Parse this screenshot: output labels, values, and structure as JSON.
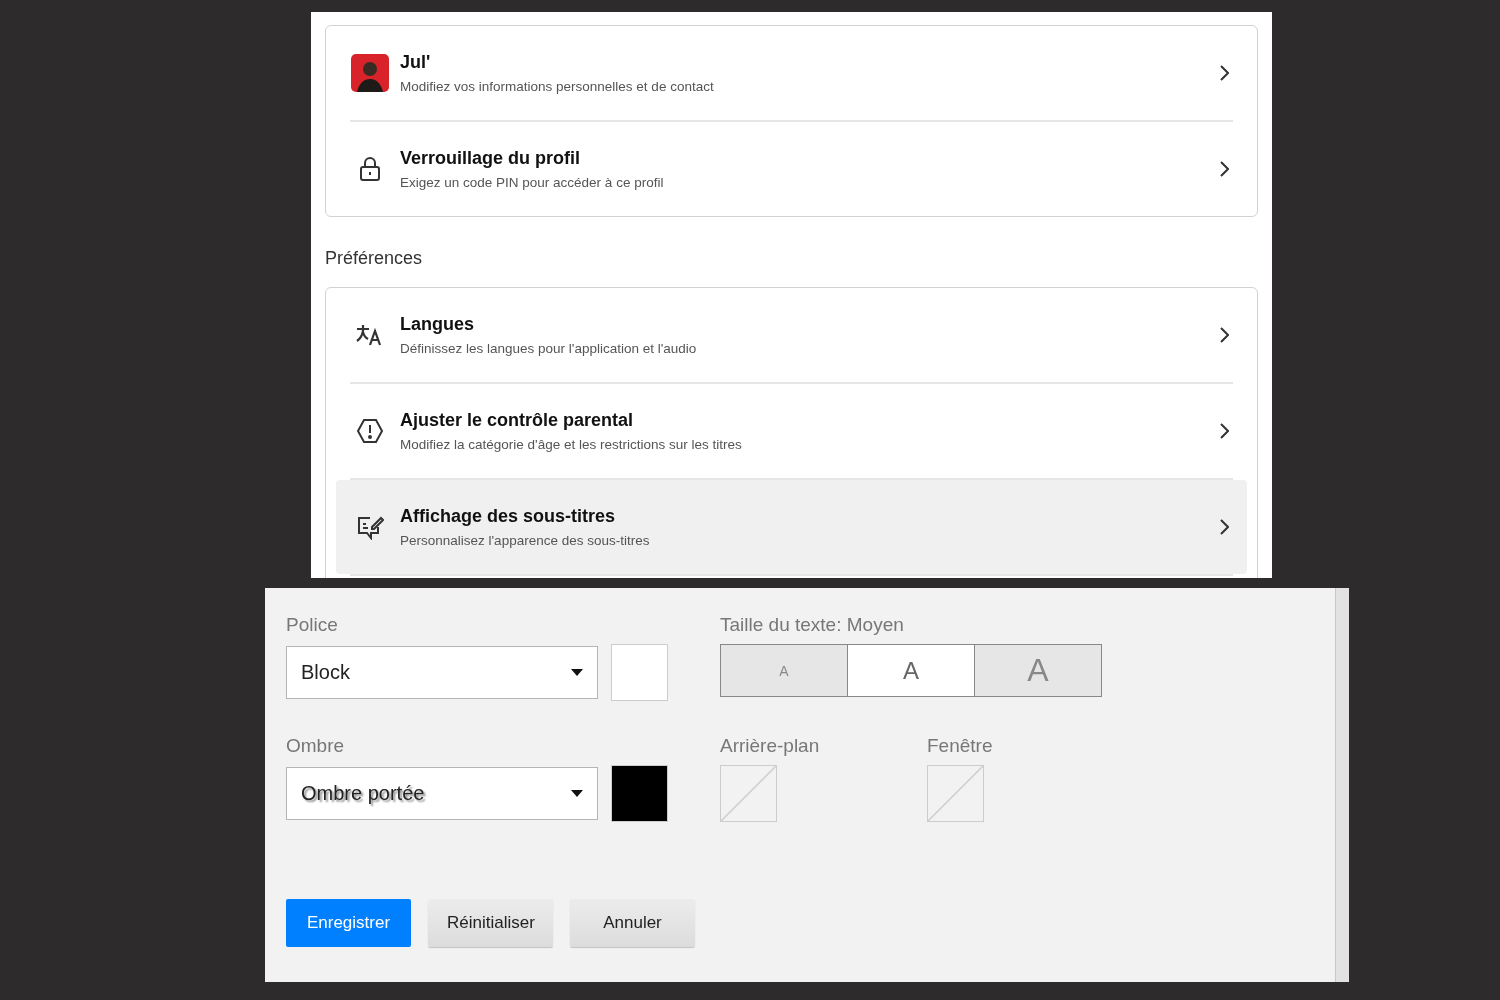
{
  "profile_card": {
    "items": [
      {
        "kind": "avatar",
        "title": "Jul'",
        "subtitle": "Modifiez vos informations personnelles et de contact",
        "selected": false
      },
      {
        "kind": "lock",
        "title": "Verrouillage du profil",
        "subtitle": "Exigez un code PIN pour accéder à ce profil",
        "selected": false
      }
    ]
  },
  "preferences": {
    "heading": "Préférences",
    "items": [
      {
        "kind": "language",
        "title": "Langues",
        "subtitle": "Définissez les langues pour l'application et l'audio",
        "selected": false
      },
      {
        "kind": "parental",
        "title": "Ajuster le contrôle parental",
        "subtitle": "Modifiez la catégorie d'âge et les restrictions sur les titres",
        "selected": false
      },
      {
        "kind": "subtitles",
        "title": "Affichage des sous-titres",
        "subtitle": "Personnalisez l'apparence des sous-titres",
        "selected": true
      }
    ]
  },
  "subtitle_settings": {
    "font": {
      "label": "Police",
      "value": "Block",
      "color": "#ffffff"
    },
    "text_size": {
      "label": "Taille du texte: Moyen",
      "options": [
        {
          "label": "A",
          "selected": false
        },
        {
          "label": "A",
          "selected": true
        },
        {
          "label": "A",
          "selected": false
        }
      ]
    },
    "shadow": {
      "label": "Ombre",
      "value": "Ombre portée",
      "color": "#000000"
    },
    "background": {
      "label": "Arrière-plan"
    },
    "window": {
      "label": "Fenêtre"
    },
    "buttons": [
      {
        "label": "Enregistrer",
        "kind": "primary"
      },
      {
        "label": "Réinitialiser",
        "kind": "secondary"
      },
      {
        "label": "Annuler",
        "kind": "secondary"
      }
    ]
  }
}
